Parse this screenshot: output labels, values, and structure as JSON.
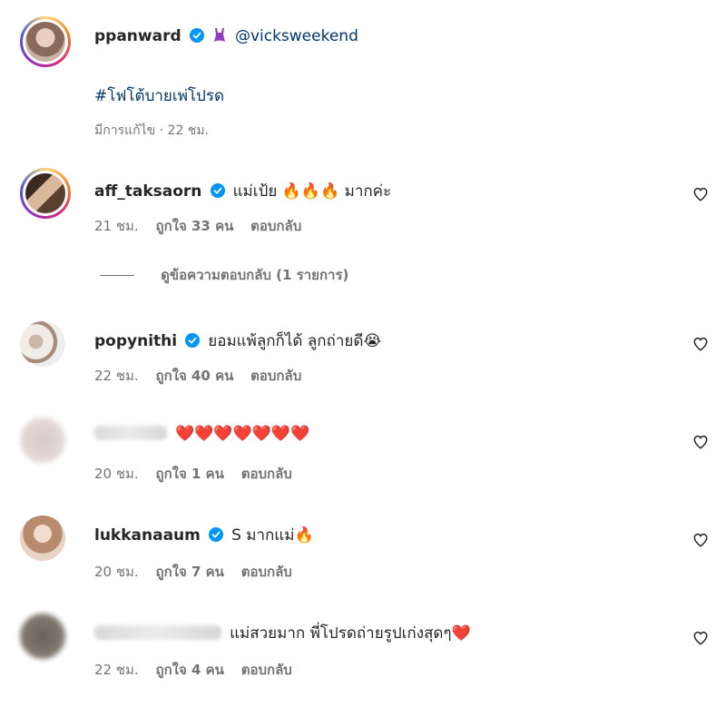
{
  "post": {
    "username": "ppanward",
    "mention": "@vicksweekend",
    "hashtag": "#โฟโต้บายเพ่โปรด",
    "meta": "มีการแก้ไข · 22 ชม."
  },
  "comments": [
    {
      "username": "aff_taksaorn",
      "verified": true,
      "text": "แม่เป้ย 🔥🔥🔥 มากค่ะ",
      "time": "21 ชม.",
      "likes": "ถูกใจ 33 คน",
      "reply": "ตอบกลับ",
      "view_replies": "ดูข้อความตอบกลับ (1 รายการ)"
    },
    {
      "username": "popynithi",
      "verified": true,
      "text": "ยอมแพ้ลูกก็ได้ ลูกถ่ายดี😭",
      "time": "22 ชม.",
      "likes": "ถูกใจ 40 คน",
      "reply": "ตอบกลับ"
    },
    {
      "username": "",
      "verified": false,
      "text": "❤️❤️❤️❤️❤️❤️❤️",
      "time": "20 ชม.",
      "likes": "ถูกใจ 1 คน",
      "reply": "ตอบกลับ"
    },
    {
      "username": "lukkanaaum",
      "verified": true,
      "text": "S มากแม่🔥",
      "time": "20 ชม.",
      "likes": "ถูกใจ 7 คน",
      "reply": "ตอบกลับ"
    },
    {
      "username": "",
      "verified": false,
      "text": "แม่สวยมาก พี่โปรดถ่ายรูปเก่งสุดๆ❤️",
      "time": "22 ชม.",
      "likes": "ถูกใจ 4 คน",
      "reply": "ตอบกลับ"
    }
  ],
  "colors": {
    "verified": "#0095f6",
    "muted": "#737373",
    "link": "#00376b",
    "heart": "#e0245e"
  }
}
